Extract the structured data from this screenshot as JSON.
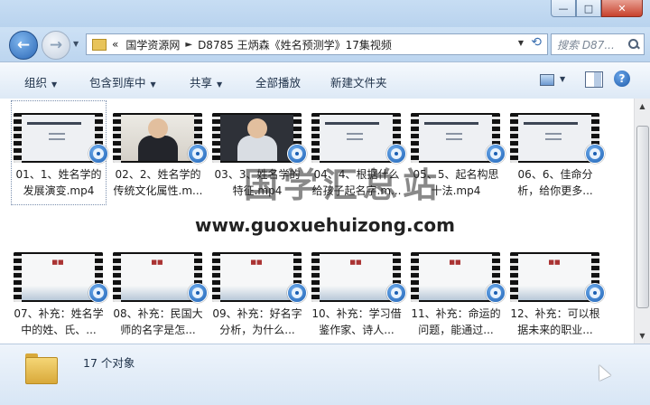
{
  "nav": {
    "recent_symbol": "▼",
    "breadcrumb": [
      "«",
      "国学资源网",
      "D8785 王炳森《姓名预测学》17集视频"
    ],
    "search_placeholder": "搜索 D87..."
  },
  "window_controls": {
    "min": "—",
    "max": "□",
    "close": "✕"
  },
  "toolbar": {
    "organize": "组织",
    "include_in_library": "包含到库中",
    "share": "共享",
    "play_all": "全部播放",
    "new_folder": "新建文件夹",
    "help": "?"
  },
  "files": [
    {
      "name": "01、1、姓名学的发展演变.mp4",
      "thumb": "slide"
    },
    {
      "name": "02、2、姓名学的传统文化属性.m...",
      "thumb": "video-light"
    },
    {
      "name": "03、3、姓名学的特征.mp4",
      "thumb": "video-dark"
    },
    {
      "name": "04、4、根据什么给孩子起名字.m...",
      "thumb": "slide"
    },
    {
      "name": "05、5、起名构思十法.mp4",
      "thumb": "slide"
    },
    {
      "name": "06、6、佳命分析，给你更多...",
      "thumb": "slide"
    },
    {
      "name": "07、补充：姓名学中的姓、氏、...",
      "thumb": "tea"
    },
    {
      "name": "08、补充：民国大师的名字是怎...",
      "thumb": "tea"
    },
    {
      "name": "09、补充：好名字分析，为什么...",
      "thumb": "tea"
    },
    {
      "name": "10、补充：学习借鉴作家、诗人...",
      "thumb": "tea"
    },
    {
      "name": "11、补充：命运的问题，能通过...",
      "thumb": "tea"
    },
    {
      "name": "12、补充：可以根据未来的职业...",
      "thumb": "tea"
    }
  ],
  "watermark": {
    "text": "国学汇总站",
    "url": "www.guoxuehuizong.com"
  },
  "details": {
    "count": "17 个对象"
  }
}
